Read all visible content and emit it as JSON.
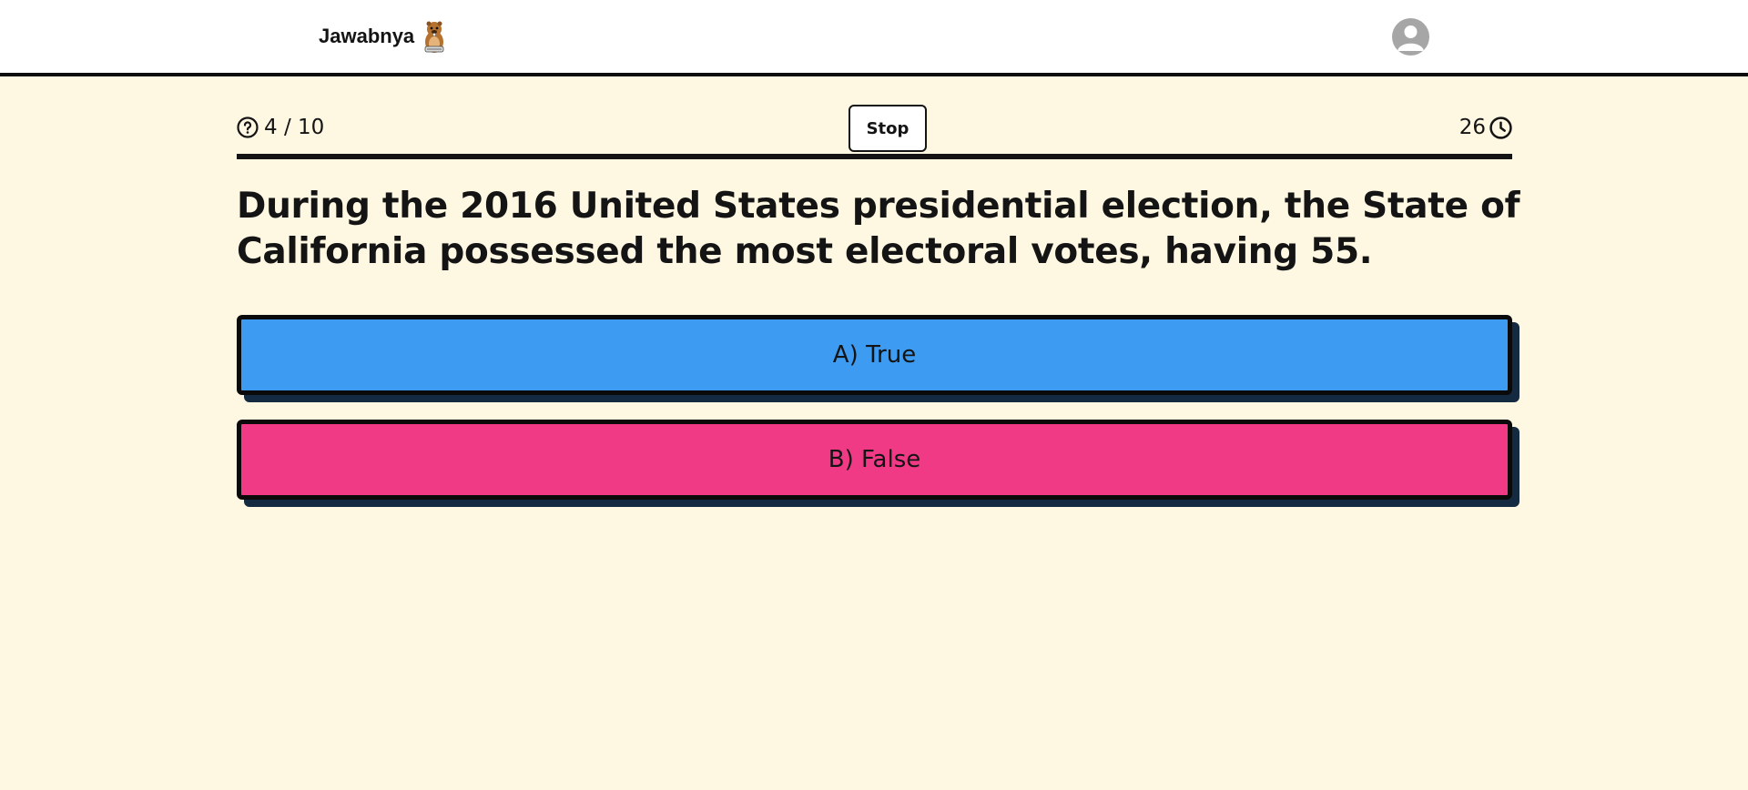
{
  "header": {
    "brand_name": "Jawabnya",
    "mascot_icon": "beaver-mascot-icon",
    "avatar_icon": "user-avatar-icon"
  },
  "quiz": {
    "progress_text": "4 / 10",
    "progress_current": 4,
    "progress_total": 10,
    "stop_label": "Stop",
    "timer_value": "26",
    "question_icon": "question-circle-icon",
    "timer_icon": "clock-icon"
  },
  "question": {
    "text": "During the 2016 United States presidential election, the State of California possessed the most electoral votes, having 55."
  },
  "options": [
    {
      "label": "A) True",
      "color": "#3d9bf2"
    },
    {
      "label": "B) False",
      "color": "#f03a85"
    }
  ],
  "colors": {
    "background": "#fef7e2",
    "text": "#141414",
    "option_shadow": "#142a40"
  }
}
